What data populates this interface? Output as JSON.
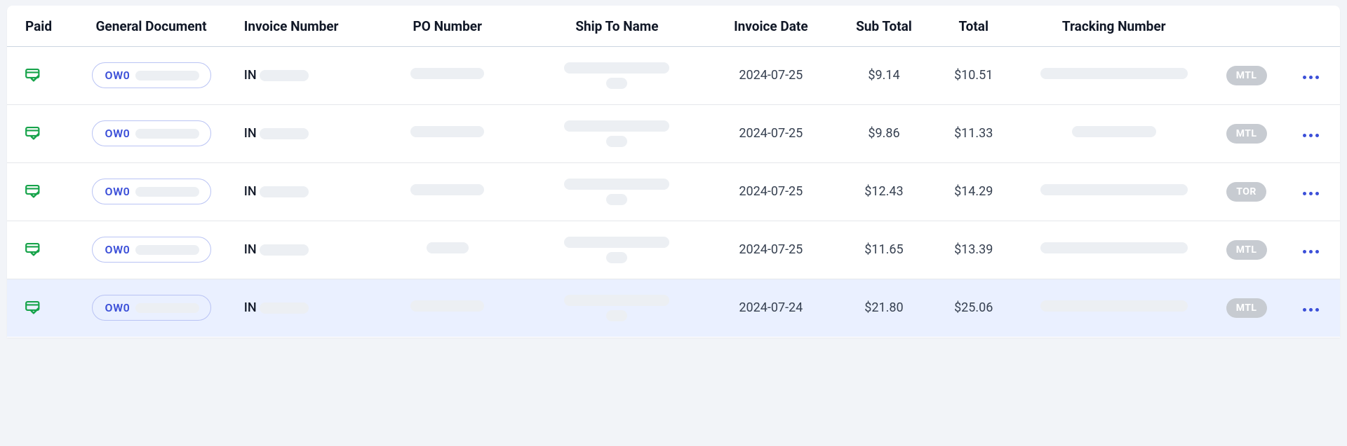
{
  "columns": {
    "paid": "Paid",
    "general_document": "General Document",
    "invoice_number": "Invoice Number",
    "po_number": "PO Number",
    "ship_to_name": "Ship To Name",
    "invoice_date": "Invoice Date",
    "sub_total": "Sub Total",
    "total": "Total",
    "tracking_number": "Tracking Number"
  },
  "rows": [
    {
      "paid": true,
      "doc_prefix": "OW0",
      "invoice_prefix": "IN",
      "invoice_date": "2024-07-25",
      "sub_total": "$9.14",
      "total": "$10.51",
      "location": "MTL",
      "selected": false
    },
    {
      "paid": true,
      "doc_prefix": "OW0",
      "invoice_prefix": "IN",
      "invoice_date": "2024-07-25",
      "sub_total": "$9.86",
      "total": "$11.33",
      "location": "MTL",
      "selected": false
    },
    {
      "paid": true,
      "doc_prefix": "OW0",
      "invoice_prefix": "IN",
      "invoice_date": "2024-07-25",
      "sub_total": "$12.43",
      "total": "$14.29",
      "location": "TOR",
      "selected": false
    },
    {
      "paid": true,
      "doc_prefix": "OW0",
      "invoice_prefix": "IN",
      "invoice_date": "2024-07-25",
      "sub_total": "$11.65",
      "total": "$13.39",
      "location": "MTL",
      "selected": false
    },
    {
      "paid": true,
      "doc_prefix": "OW0",
      "invoice_prefix": "IN",
      "invoice_date": "2024-07-24",
      "sub_total": "$21.80",
      "total": "$25.06",
      "location": "MTL",
      "selected": true
    }
  ]
}
